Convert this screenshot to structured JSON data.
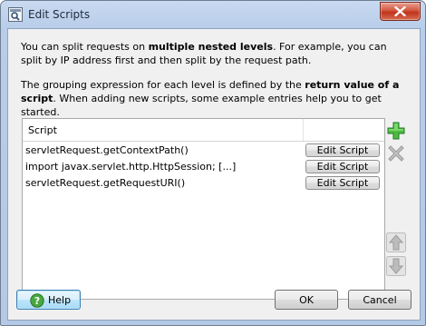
{
  "window": {
    "title": "Edit Scripts",
    "close_icon": "close-icon"
  },
  "intro": {
    "p1_before": "You can split requests on ",
    "p1_bold": "multiple nested levels",
    "p1_after": ". For example, you can split by IP address first and then split by the request path.",
    "p2_before": "The grouping expression for each level is defined by the ",
    "p2_bold": "return value of a script",
    "p2_after": ". When adding new scripts, some example entries help you to get started."
  },
  "table": {
    "header": "Script",
    "rows": [
      {
        "script": "servletRequest.getContextPath()",
        "button": "Edit Script"
      },
      {
        "script": "import javax.servlet.http.HttpSession; [...]",
        "button": "Edit Script"
      },
      {
        "script": "servletRequest.getRequestURI()",
        "button": "Edit Script"
      }
    ]
  },
  "side_buttons": {
    "add": "plus-icon",
    "remove": "cross-icon",
    "up": "arrow-up-icon",
    "down": "arrow-down-icon"
  },
  "footer": {
    "help_label": "Help",
    "ok_label": "OK",
    "cancel_label": "Cancel"
  },
  "colors": {
    "add_green": "#3aa335",
    "disabled_gray": "#b9b9b9",
    "help_accent": "#3c7fb1"
  }
}
